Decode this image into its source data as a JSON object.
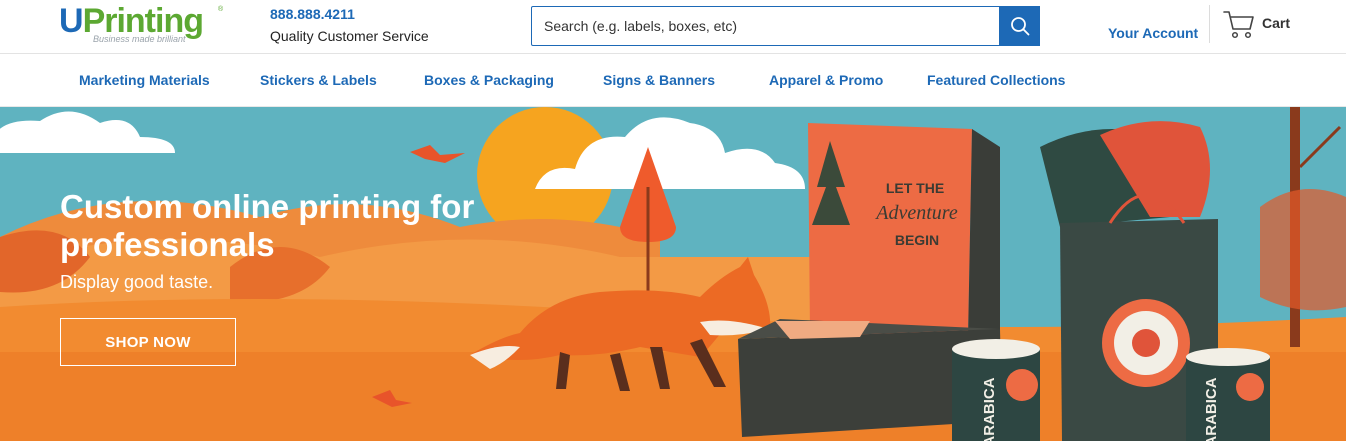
{
  "header": {
    "logo": {
      "mark": "U",
      "word": "Printing",
      "registered": "®",
      "tagline": "Business made brilliant"
    },
    "phone": "888.888.4211",
    "service_label": "Quality Customer Service",
    "search": {
      "placeholder": "Search (e.g. labels, boxes, etc)",
      "value": ""
    },
    "account_label": "Your Account",
    "cart_label": "Cart",
    "icons": {
      "search": "search-icon",
      "cart": "cart-icon"
    }
  },
  "nav": {
    "items": [
      {
        "label": "Marketing Materials"
      },
      {
        "label": "Stickers & Labels"
      },
      {
        "label": "Boxes & Packaging"
      },
      {
        "label": "Signs & Banners"
      },
      {
        "label": "Apparel & Promo"
      },
      {
        "label": "Featured Collections"
      }
    ]
  },
  "hero": {
    "title": "Custom online printing for professionals",
    "subtitle": "Display good taste.",
    "cta_label": "SHOP NOW",
    "artwork_text": {
      "box_line1": "LET THE",
      "box_line2": "Adventure",
      "box_line3": "BEGIN",
      "label_text": "ARABICA"
    }
  },
  "colors": {
    "brand_blue": "#1d69b6",
    "brand_green": "#5ca832",
    "sky": "#5fb3c0",
    "orange": "#f07a2e",
    "dark_green": "#2f4a42"
  }
}
